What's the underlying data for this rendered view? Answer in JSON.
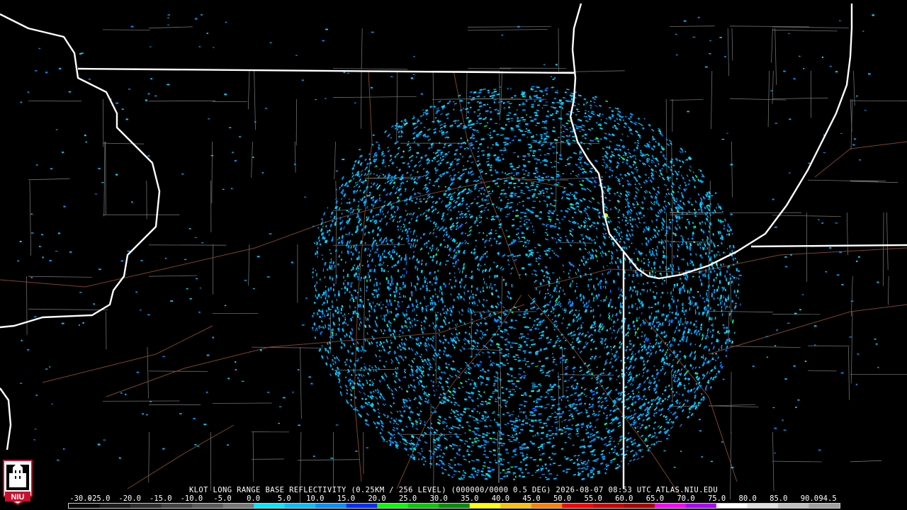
{
  "caption": "KLOT LONG RANGE BASE REFLECTIVITY (0.25KM / 256 LEVEL) (000000/0000 0.5 DEG) 2026-08-07 08:53 UTC  ATLAS.NIU.EDU",
  "logo": {
    "text": "NIU",
    "icon": "niu-tower-logo",
    "color": "#c8102e"
  },
  "scale": {
    "labels": [
      "-30.0",
      "-25.0",
      "-20.0",
      "-15.0",
      "-10.0",
      "-5.0",
      "0.0",
      "5.0",
      "10.0",
      "15.0",
      "20.0",
      "25.0",
      "30.0",
      "35.0",
      "40.0",
      "45.0",
      "50.0",
      "55.0",
      "60.0",
      "65.0",
      "70.0",
      "75.0",
      "80.0",
      "85.0",
      "90.0",
      "94.5"
    ],
    "colors": [
      "#0a0a0a",
      "#1c1c1c",
      "#2e2e2e",
      "#444444",
      "#5a5a5a",
      "#777777",
      "#00e8ff",
      "#00c0ff",
      "#0090ff",
      "#0030ff",
      "#00ff00",
      "#00cc00",
      "#009000",
      "#ffff00",
      "#ffc000",
      "#ff8000",
      "#ff0000",
      "#d00000",
      "#b00000",
      "#ff00ff",
      "#b000ff",
      "#ffffff",
      "#e0e0e0",
      "#c0c0c0",
      "#a0a0a0"
    ]
  },
  "map": {
    "background": "#000000",
    "state_border_color": "#ffffff",
    "county_border_color": "#8a8a8a",
    "highway_color": "#8b4a2b",
    "echo_colors": [
      "#00d8ff",
      "#00b4ff",
      "#0090ff",
      "#1060ff",
      "#40e0d0",
      "#00ff80"
    ],
    "radar_site": "KLOT"
  }
}
